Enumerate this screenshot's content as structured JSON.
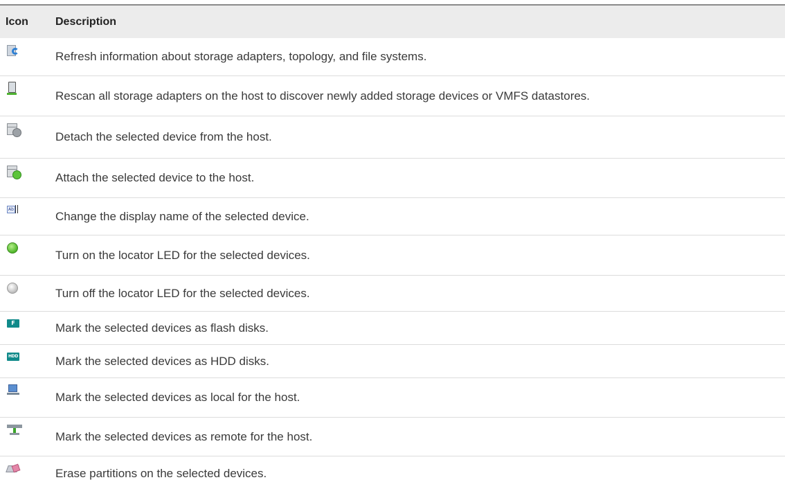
{
  "table": {
    "headers": {
      "icon": "Icon",
      "description": "Description"
    },
    "rows": [
      {
        "icon": "refresh-icon",
        "description": "Refresh information about storage adapters, topology, and file systems."
      },
      {
        "icon": "rescan-icon",
        "description": "Rescan all storage adapters on the host to discover newly added storage devices or VMFS datastores."
      },
      {
        "icon": "detach-device-icon",
        "description": "Detach the selected device from the host."
      },
      {
        "icon": "attach-device-icon",
        "description": "Attach the selected device to the host."
      },
      {
        "icon": "rename-icon",
        "description": "Change the display name of the selected device.",
        "icon_text": "Ab"
      },
      {
        "icon": "locator-led-on-icon",
        "description": "Turn on the locator LED for the selected devices."
      },
      {
        "icon": "locator-led-off-icon",
        "description": "Turn off the locator LED for the selected devices."
      },
      {
        "icon": "flash-disk-icon",
        "description": "Mark the selected devices as flash disks.",
        "icon_text": "F"
      },
      {
        "icon": "hdd-disk-icon",
        "description": "Mark the selected devices as HDD disks.",
        "icon_text": "HDD"
      },
      {
        "icon": "local-device-icon",
        "description": "Mark the selected devices as local for the host."
      },
      {
        "icon": "remote-device-icon",
        "description": "Mark the selected devices as remote for the host."
      },
      {
        "icon": "erase-partitions-icon",
        "description": "Erase partitions on the selected devices."
      }
    ]
  },
  "colors": {
    "header_background": "#ececec",
    "row_divider": "#dcdcdc",
    "flash_hdd_badge": "#108a8a",
    "led_on": "#4fb52a"
  }
}
